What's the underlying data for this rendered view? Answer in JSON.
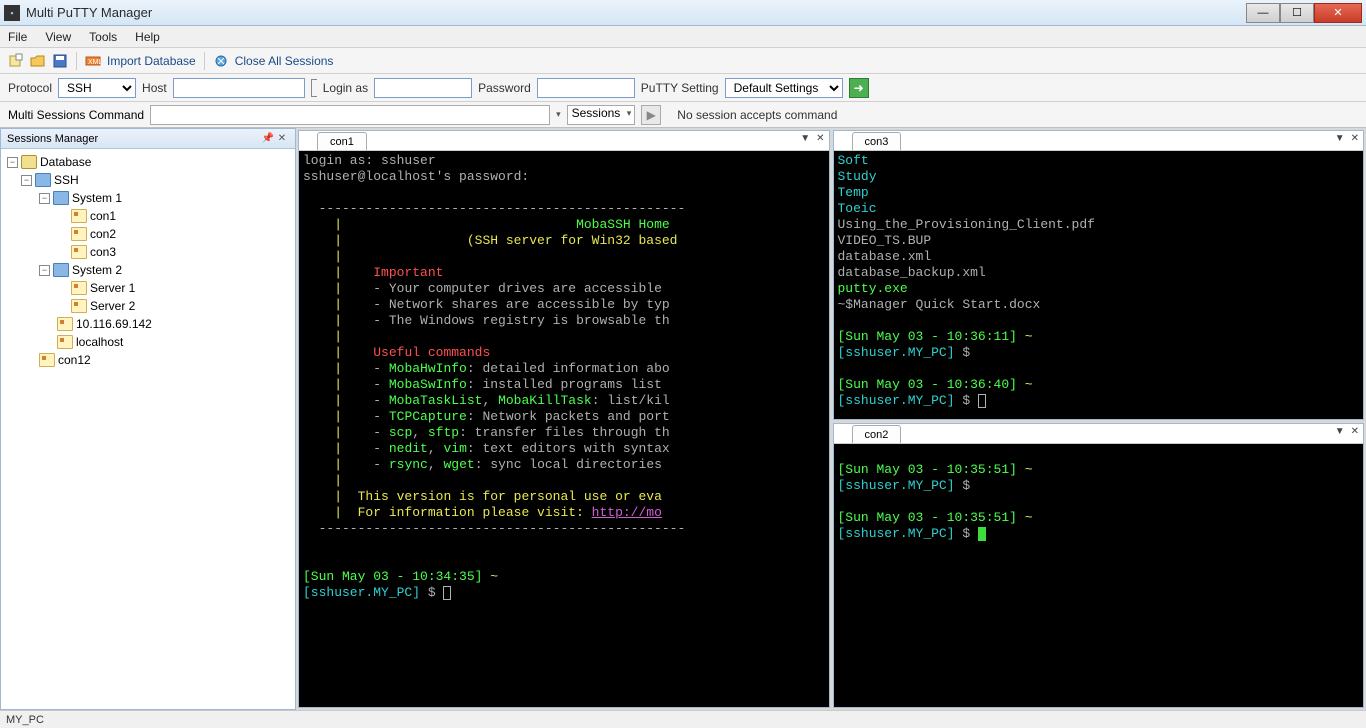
{
  "window": {
    "title": "Multi PuTTY Manager"
  },
  "menu": {
    "file": "File",
    "view": "View",
    "tools": "Tools",
    "help": "Help"
  },
  "toolbar1": {
    "import_db": "Import Database",
    "close_all": "Close All Sessions"
  },
  "toolbar2": {
    "protocol_label": "Protocol",
    "protocol_value": "SSH",
    "host_label": "Host",
    "host_value": "",
    "login_label": "Login as",
    "login_value": "",
    "password_label": "Password",
    "password_value": "",
    "putty_setting_label": "PuTTY Setting",
    "putty_setting_value": "Default Settings"
  },
  "toolbar3": {
    "label": "Multi Sessions Command",
    "command_value": "",
    "sessions_label": "Sessions",
    "status": "No session accepts command"
  },
  "panel": {
    "title": "Sessions Manager"
  },
  "tree": {
    "root": "Database",
    "ssh": "SSH",
    "system1": "System 1",
    "con1": "con1",
    "con2": "con2",
    "con3": "con3",
    "system2": "System 2",
    "server1": "Server 1",
    "server2": "Server 2",
    "ip": "10.116.69.142",
    "localhost": "localhost",
    "con12": "con12"
  },
  "tabs": {
    "con1": "con1",
    "con2": "con2",
    "con3": "con3"
  },
  "con1": {
    "l1": "login as: sshuser",
    "l2": "sshuser@localhost's password:",
    "dash": "  -----------------------------------------------",
    "bar": "    |",
    "title": "MobaSSH Home",
    "sub": "(SSH server for Win32 based",
    "important": "Important",
    "imp1": "- Your computer drives are accessible",
    "imp2": "- Network shares are accessible by typ",
    "imp3": "- The Windows registry is browsable th",
    "useful": "Useful commands",
    "c1a": "MobaHwInfo",
    "c1b": ": detailed information abo",
    "c2a": "MobaSwInfo",
    "c2b": ": installed programs list",
    "c3a": "MobaTaskList",
    "c3b": ", ",
    "c3c": "MobaKillTask",
    "c3d": ": list/kil",
    "c4a": "TCPCapture",
    "c4b": ": Network packets and port",
    "c5a": "scp",
    "c5b": ", ",
    "c5c": "sftp",
    "c5d": ": transfer files through th",
    "c6a": "nedit",
    "c6b": ", ",
    "c6c": "vim",
    "c6d": ": text editors with syntax",
    "c7a": "rsync",
    "c7b": ", ",
    "c7c": "wget",
    "c7d": ": sync local directories",
    "eval": "This version is for personal use or eva",
    "info": "For information please visit: ",
    "link": "http://mo",
    "ts": "[Sun May 03 - 10:34:35]",
    "tilde": " ~",
    "prompt": "[sshuser.MY_PC]",
    "dollar": " $ "
  },
  "con3": {
    "soft": "Soft",
    "study": "Study",
    "temp": "Temp",
    "toeic": "Toeic",
    "f1": "Using_the_Provisioning_Client.pdf",
    "f2": "VIDEO_TS.BUP",
    "f3": "database.xml",
    "f4": "database_backup.xml",
    "f5": "putty.exe",
    "f6": "~$Manager Quick Start.docx",
    "ts1": "[Sun May 03 - 10:36:11]",
    "tilde": " ~",
    "prompt": "[sshuser.MY_PC]",
    "dollar": " $",
    "ts2": "[Sun May 03 - 10:36:40]"
  },
  "con2": {
    "ts1": "[Sun May 03 - 10:35:51]",
    "tilde": " ~",
    "prompt": "[sshuser.MY_PC]",
    "dollar": " $",
    "ts2": "[Sun May 03 - 10:35:51]"
  },
  "status": {
    "text": "MY_PC"
  }
}
